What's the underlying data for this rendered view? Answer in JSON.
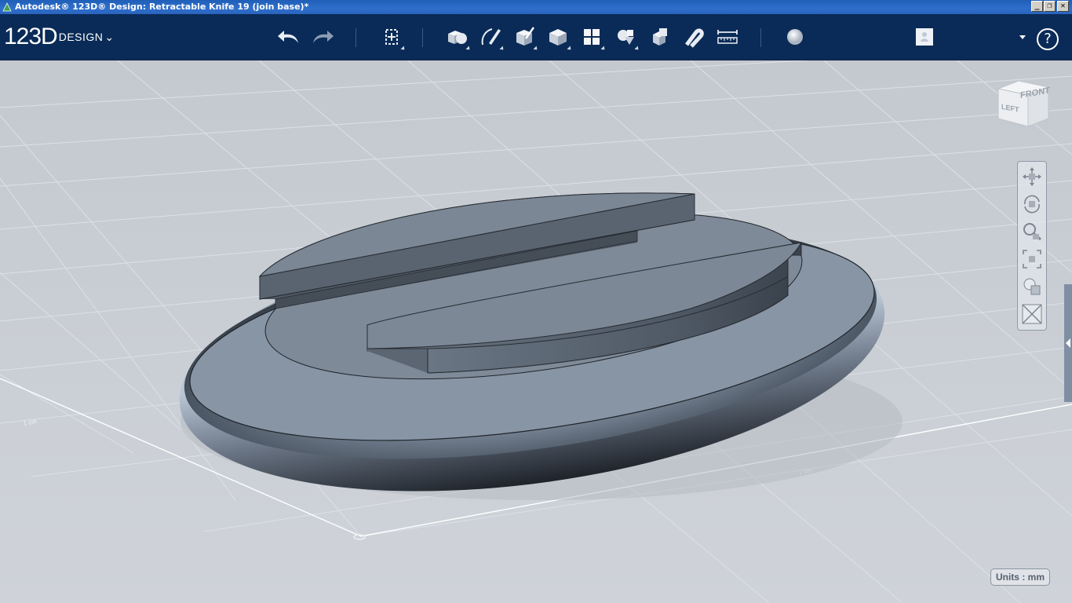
{
  "window": {
    "title": "Autodesk® 123D® Design: Retractable Knife 19 (join base)*",
    "buttons": {
      "minimize": "_",
      "restore": "❐",
      "close": "✕"
    }
  },
  "app": {
    "logo_main": "123D",
    "logo_sub": "DESIGN",
    "menu_chevron": "⌄"
  },
  "toolbar": {
    "items": [
      {
        "name": "undo-icon"
      },
      {
        "name": "redo-icon"
      },
      {
        "name": "transform-icon"
      },
      {
        "name": "primitives-icon"
      },
      {
        "name": "sketch-icon"
      },
      {
        "name": "construct-icon"
      },
      {
        "name": "modify-icon"
      },
      {
        "name": "pattern-icon"
      },
      {
        "name": "grouping-icon"
      },
      {
        "name": "combine-icon"
      },
      {
        "name": "snap-icon"
      },
      {
        "name": "measure-icon"
      },
      {
        "name": "material-icon"
      },
      {
        "name": "gallery-icon"
      }
    ],
    "help_label": "?",
    "account_icon": "user-icon"
  },
  "viewport": {
    "viewcube": {
      "left_label": "LEFT",
      "front_label": "FRONT"
    },
    "grid_label_left": "1 cm",
    "grid_label_right": "1 cm",
    "units_label": "Units : mm"
  },
  "navbar": {
    "items": [
      "pan-icon",
      "orbit-icon",
      "zoom-icon",
      "fit-icon",
      "views-icon",
      "visibility-icon"
    ]
  },
  "colors": {
    "toolbar_bg": "#0a2b57",
    "viewport_bg": "#c9ced5",
    "model_surface": "#7d8896"
  }
}
